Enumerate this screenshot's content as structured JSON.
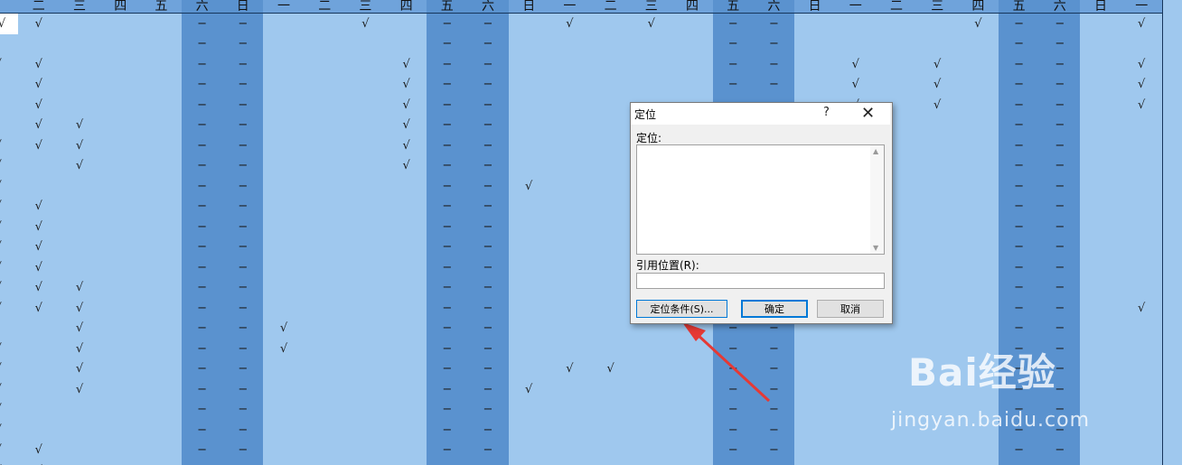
{
  "weekday_labels": [
    "一",
    "二",
    "三",
    "四",
    "五",
    "六",
    "日"
  ],
  "header_row": [
    "二",
    "三",
    "四",
    "五",
    "六",
    "日",
    "一",
    "二",
    "三",
    "四",
    "五",
    "六",
    "日",
    "一",
    "二",
    "三",
    "四",
    "五",
    "六",
    "日",
    "一",
    "二",
    "三",
    "四",
    "五",
    "六",
    "日",
    "一"
  ],
  "weekend_columns": [
    5,
    6,
    11,
    12,
    18,
    19,
    25,
    26
  ],
  "marks": {
    "check": "√",
    "dash": "−"
  },
  "grid_rows": [
    "√√-------√----√-√-√-----√√--√--√--√------",
    "-------------------------------------------",
    "√√--------√--------√-√-√----√-√-√---------",
    "-√---√----√-√------√-√-√----√-√-√---------",
    "-√---√----√-√------√-√-√----√-√-√---------",
    "-√√--√----√-√------√---------√-√-√--------",
    "√√√--√----√-√------√√----------√-√--------",
    "√-√--√----√-√-------√----------√√---------",
    "√----√------√√------√---------√-√---------",
    "√√---√------√-------√---------√-√---------",
    "√√---√------√-------√---------√-√---------",
    "√√---√------√-------√---------√-√---------",
    "√√----------√-----------------√-√---------",
    "√√√---------√-----------------------------",
    "√√√-------------------------√---√-√-------",
    "--√----√------------------------√-√-------",
    "√-√----√------------------------√---------",
    "√-√-----------√√---------------√---------",
    "√-√---------√√-----------------√---------",
    "√-----------√-----------------------------",
    "√-----------√-----------------------------",
    "√√----------√-----------------------------",
    "√√-----------------------------------------"
  ],
  "first_cell_value": "√",
  "dialog": {
    "title": "定位",
    "help": "?",
    "close": "✕",
    "goto_label": "定位:",
    "reference_label": "引用位置(R):",
    "reference_value": "",
    "special_button": "定位条件(S)...",
    "ok_button": "确定",
    "cancel_button": "取消"
  },
  "watermark": {
    "logo_text": "Bai经验",
    "url": "jingyan.baidu.com"
  },
  "colors": {
    "light_cell": "#9fc8ee",
    "weekend_cell": "#5a92cf",
    "header_cell": "#6fa3db",
    "grid_line": "#16365c",
    "arrow": "#e53935",
    "dialog_accent": "#0078d7"
  }
}
